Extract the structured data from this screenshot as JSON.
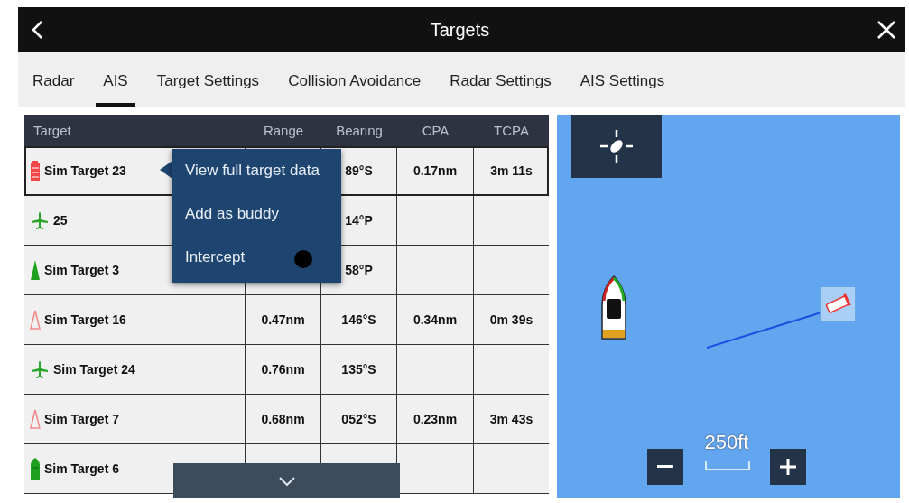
{
  "title_bar": {
    "title": "Targets"
  },
  "tabs": [
    {
      "label": "Radar",
      "selected": false
    },
    {
      "label": "AIS",
      "selected": true
    },
    {
      "label": "Target Settings",
      "selected": false
    },
    {
      "label": "Collision Avoidance",
      "selected": false
    },
    {
      "label": "Radar Settings",
      "selected": false
    },
    {
      "label": "AIS Settings",
      "selected": false
    }
  ],
  "table": {
    "columns": [
      "Target",
      "Range",
      "Bearing",
      "CPA",
      "TCPA"
    ],
    "rows": [
      {
        "name": "Sim Target 23",
        "kind": "buoy",
        "color": "#f04848",
        "selected": true,
        "bearing": "89°S",
        "cpa": "0.17nm",
        "tcpa": "3m 11s"
      },
      {
        "name": "25",
        "kind": "aircraft",
        "color": "#2aa52a",
        "selected": false,
        "bearing": "14°P"
      },
      {
        "name": "Sim Target 3",
        "kind": "triangle",
        "color": "#1fa01f",
        "selected": false,
        "bearing": "58°P"
      },
      {
        "name": "Sim Target 16",
        "kind": "triangle-outline",
        "color": "#f08a8a",
        "selected": false,
        "range": "0.47nm",
        "bearing": "146°S",
        "cpa": "0.34nm",
        "tcpa": "0m 39s"
      },
      {
        "name": "Sim Target 24",
        "kind": "aircraft",
        "color": "#2aa52a",
        "selected": false,
        "range": "0.76nm",
        "bearing": "135°S"
      },
      {
        "name": "Sim Target 7",
        "kind": "triangle-outline",
        "color": "#f08a8a",
        "selected": false,
        "range": "0.68nm",
        "bearing": "052°S",
        "cpa": "0.23nm",
        "tcpa": "3m 43s"
      },
      {
        "name": "Sim Target 6",
        "kind": "ship",
        "color": "#1fa01f",
        "selected": false
      }
    ]
  },
  "context_menu": {
    "items": [
      "View full target data",
      "Add as buddy",
      "Intercept"
    ]
  },
  "map": {
    "scale": "250ft"
  }
}
